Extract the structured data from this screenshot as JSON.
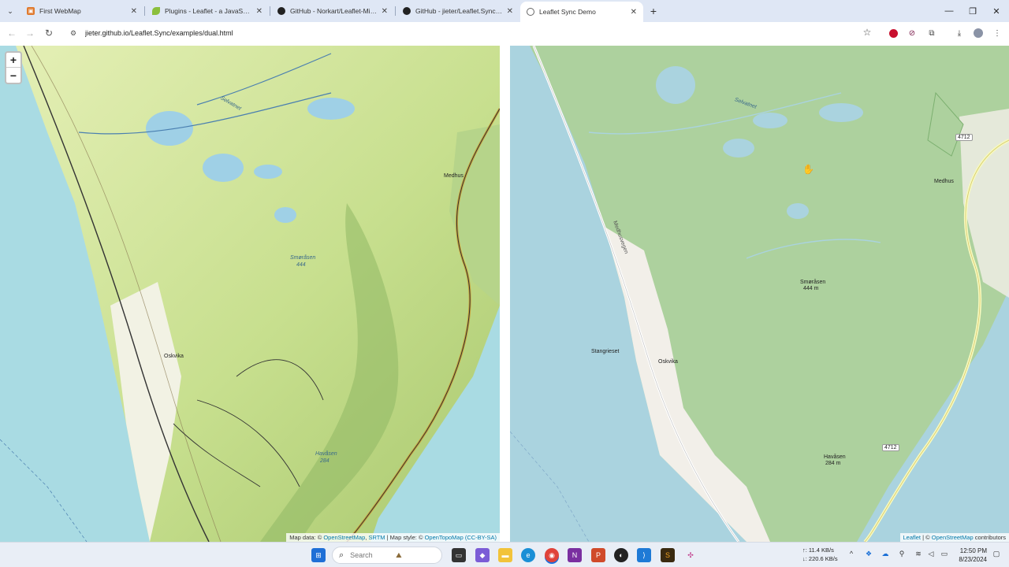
{
  "browser": {
    "tabs": [
      {
        "title": "First WebMap",
        "icon": "webmap-favicon-icon",
        "active": false
      },
      {
        "title": "Plugins - Leaflet - a JavaScript l",
        "icon": "leaflet-favicon-icon",
        "active": false
      },
      {
        "title": "GitHub - Norkart/Leaflet-MiniM",
        "icon": "github-icon",
        "active": false
      },
      {
        "title": "GitHub - jieter/Leaflet.Sync: Sy",
        "icon": "github-icon",
        "active": false
      },
      {
        "title": "Leaflet Sync Demo",
        "icon": "globe-icon",
        "active": true
      }
    ],
    "address": "jieter.github.io/Leaflet.Sync/examples/dual.html"
  },
  "map_left": {
    "zoom_in": "+",
    "zoom_out": "−",
    "labels": {
      "selvatnet": "Selvatnet",
      "medhus": "Medhus",
      "smorasen": "Smøråsen",
      "smorasen_elev": "444",
      "oskvika": "Oskvika",
      "havasen": "Havåsen",
      "havasen_elev": "284"
    },
    "attribution": {
      "prefix": "Map data: © ",
      "osm": "OpenStreetMap",
      "sep1": ", ",
      "srtm": "SRTM",
      "mid": " | Map style: © ",
      "otm": "OpenTopoMap",
      "license": " (CC-BY-SA)"
    }
  },
  "map_right": {
    "labels": {
      "selvatnet": "Selvatnet",
      "medhus": "Medhus",
      "smorasen": "Smøråsen",
      "smorasen_elev": "444 m",
      "oskvika": "Oskvika",
      "stangrieset": "Stangrieset",
      "havasen": "Havåsen",
      "havasen_elev": "284 m",
      "road_4712_a": "4712",
      "road_4712_b": "4712",
      "medhus_road": "Medhusvegen"
    },
    "attribution": {
      "leaflet": "Leaflet",
      "sep": " | © ",
      "osm": "OpenStreetMap",
      "suffix": " contributors"
    }
  },
  "taskbar": {
    "search_placeholder": "Search",
    "net_up": "↑: 11.4 KB/s",
    "net_down": "↓: 220.6 KB/s",
    "time": "12:50 PM",
    "date": "8/23/2024"
  }
}
